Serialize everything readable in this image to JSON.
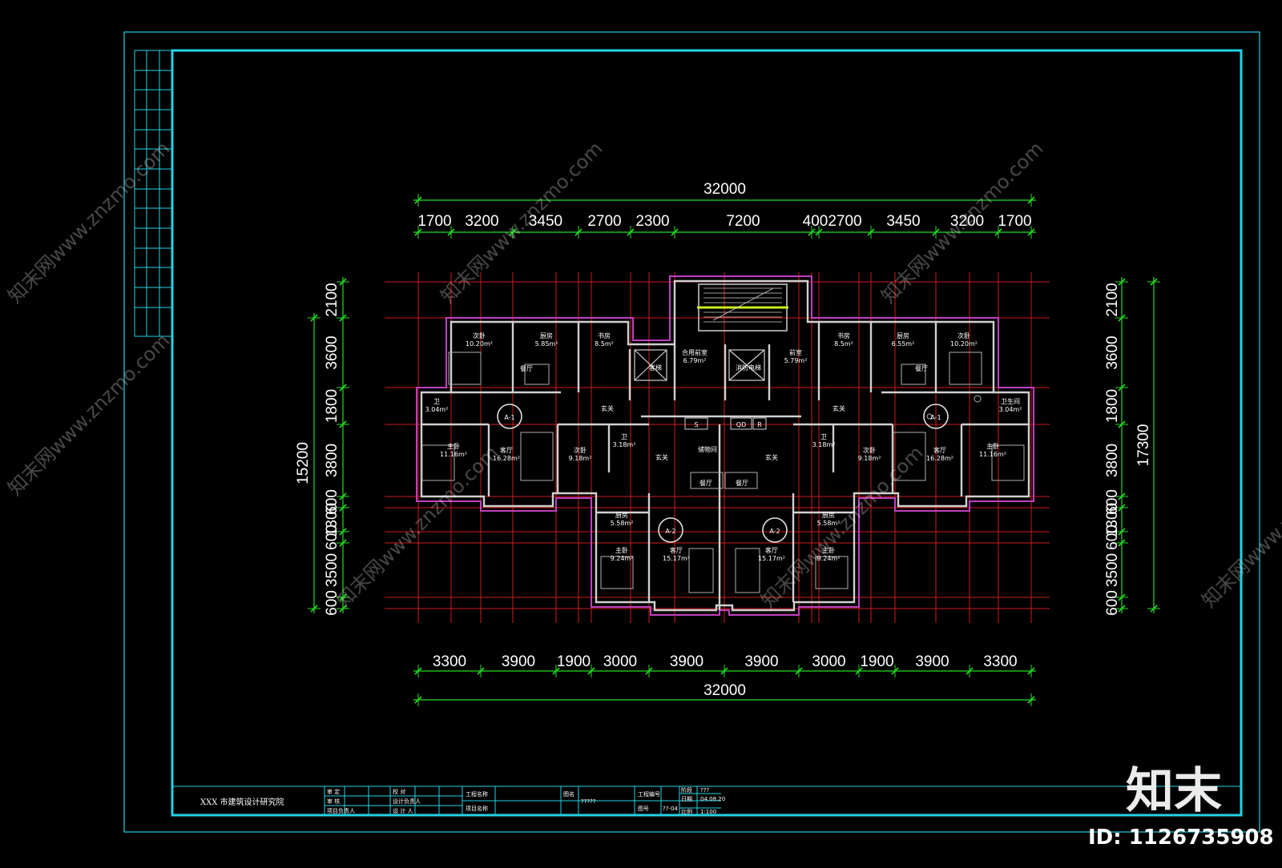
{
  "colors": {
    "frame": "#22d3e6",
    "grid": "#d01a1a",
    "dimension": "#22dd22",
    "wall": "#d8d8d8",
    "outline": "#c040c0",
    "text": "#ffffff",
    "stair": "#c8f020",
    "background": "#000000"
  },
  "dimensions": {
    "overall_top": "32000",
    "top": [
      "1700",
      "3200",
      "3450",
      "2700",
      "2300",
      "7200",
      "400",
      "2700",
      "3450",
      "3200",
      "1700"
    ],
    "bottom": [
      "3300",
      "3900",
      "1900",
      "3000",
      "3900",
      "3900",
      "3000",
      "1900",
      "3900",
      "3300"
    ],
    "overall_bottom": "32000",
    "left": [
      "2100",
      "3600",
      "1800",
      "3800",
      "600",
      "1300",
      "600",
      "3500",
      "600"
    ],
    "left_total": "15200",
    "right": [
      "2100",
      "3600",
      "1800",
      "3800",
      "600",
      "1300",
      "600",
      "3500",
      "600"
    ],
    "right_total": "17300"
  },
  "unit_tags": [
    "A-1",
    "A-1",
    "A-2",
    "A-2"
  ],
  "rooms": [
    {
      "name": "次卧",
      "area": "10.20m²"
    },
    {
      "name": "厨房",
      "area": "5.85m²"
    },
    {
      "name": "书房",
      "area": "8.5m²"
    },
    {
      "name": "餐厅",
      "area": ""
    },
    {
      "name": "卫",
      "area": "3.04m²"
    },
    {
      "name": "主卧",
      "area": "11.16m²"
    },
    {
      "name": "客厅",
      "area": "16.28m²"
    },
    {
      "name": "次卧",
      "area": "9.18m²"
    },
    {
      "name": "卫",
      "area": "3.18m²"
    },
    {
      "name": "玄关",
      "area": ""
    },
    {
      "name": "合用前室",
      "area": "6.79m²"
    },
    {
      "name": "前室",
      "area": "5.79m²"
    },
    {
      "name": "客梯",
      "area": ""
    },
    {
      "name": "消防电梯",
      "area": ""
    },
    {
      "name": "储物间",
      "area": ""
    },
    {
      "name": "玄关",
      "area": ""
    },
    {
      "name": "书房",
      "area": "8.5m²"
    },
    {
      "name": "厨房",
      "area": "6.55m²"
    },
    {
      "name": "次卧",
      "area": "10.20m²"
    },
    {
      "name": "餐厅",
      "area": ""
    },
    {
      "name": "玄关",
      "area": ""
    },
    {
      "name": "卫生间",
      "area": "3.04m²"
    },
    {
      "name": "主卧",
      "area": "11.16m²"
    },
    {
      "name": "客厅",
      "area": "16.28m²"
    },
    {
      "name": "次卧",
      "area": "9.18m²"
    },
    {
      "name": "卫",
      "area": "3.18m²"
    },
    {
      "name": "玄关",
      "area": ""
    },
    {
      "name": "餐厅",
      "area": ""
    },
    {
      "name": "餐厅",
      "area": ""
    },
    {
      "name": "厨房",
      "area": "5.58m²"
    },
    {
      "name": "主卧",
      "area": "9.24m²"
    },
    {
      "name": "客厅",
      "area": "15.17m²"
    },
    {
      "name": "客厅",
      "area": "15.17m²"
    },
    {
      "name": "厨房",
      "area": "5.58m²"
    },
    {
      "name": "主卧",
      "area": "9.24m²"
    }
  ],
  "core_tags": [
    "S",
    "QD",
    "R"
  ],
  "title_block": {
    "institute": "XXX 市建筑设计研究院",
    "fields": [
      "审 定",
      "审 核",
      "项目负责人",
      "校 对",
      "设计负责人",
      "设 计 人",
      "工程名称",
      "项目名称",
      "图名",
      "?????",
      "工程编号",
      "图号",
      "??-04",
      "阶段",
      "???",
      "日期",
      "04.08.20",
      "比例",
      "1:100"
    ]
  },
  "watermark": {
    "site": "知末网www.znzmo.com",
    "logo": "知末",
    "id": "ID: 1126735908"
  }
}
